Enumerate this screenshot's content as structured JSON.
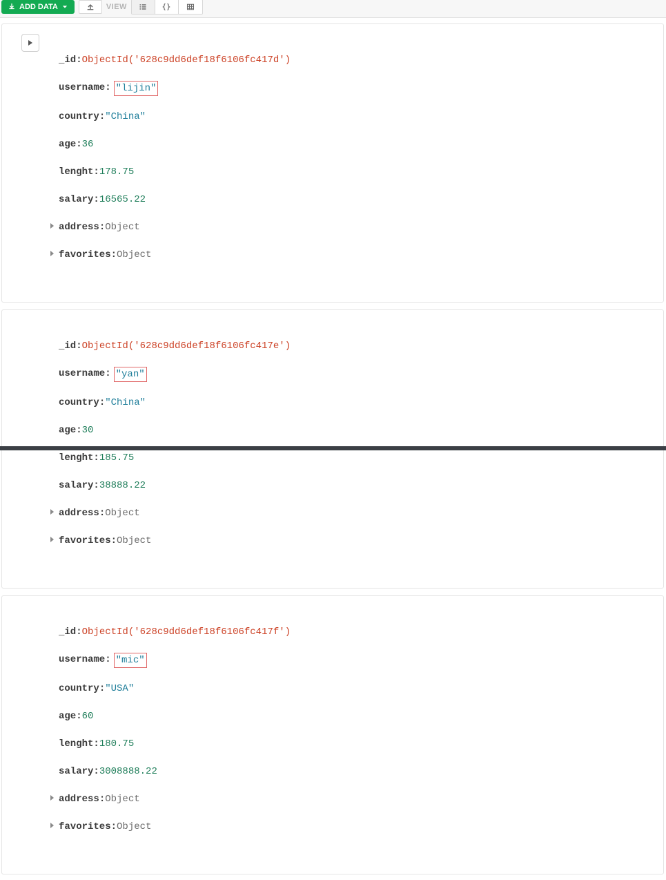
{
  "toolbar": {
    "add_label": "ADD DATA",
    "view_label": "VIEW"
  },
  "docs": [
    {
      "id_fn": "ObjectId(",
      "id_val": "'628c9dd6def18f6106fc417d'",
      "id_close": ")",
      "username": "\"lijin\"",
      "country": "\"China\"",
      "age": "36",
      "lenght": "178.75",
      "salary": "16565.22",
      "address": "Object",
      "favorites": "Object"
    },
    {
      "id_fn": "ObjectId(",
      "id_val": "'628c9dd6def18f6106fc417e'",
      "id_close": ")",
      "username": "\"yan\"",
      "country": "\"China\"",
      "age": "30",
      "lenght": "185.75",
      "salary": "38888.22",
      "address": "Object",
      "favorites": "Object"
    },
    {
      "id_fn": "ObjectId(",
      "id_val": "'628c9dd6def18f6106fc417f'",
      "id_close": ")",
      "username": "\"mic\"",
      "country": "\"USA\"",
      "age": "60",
      "lenght": "180.75",
      "salary": "3008888.22",
      "address": "Object",
      "favorites": "Object"
    }
  ],
  "labels": {
    "id": "_id",
    "username": "username",
    "country": "country",
    "age": "age",
    "lenght": "lenght",
    "salary": "salary",
    "address": "address",
    "favorites": "favorites"
  }
}
